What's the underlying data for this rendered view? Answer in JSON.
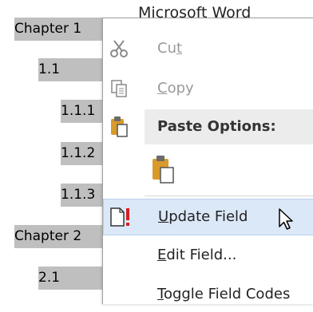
{
  "document": {
    "toc": [
      {
        "label": "Chapter 1"
      },
      {
        "label": "1.1"
      },
      {
        "label": "1.1.1"
      },
      {
        "label": "1.1.2"
      },
      {
        "label": "1.1.3"
      },
      {
        "label": "Chapter 2"
      },
      {
        "label": "2.1"
      }
    ]
  },
  "menu": {
    "title": "Microsoft Word",
    "cut": {
      "label_pre": "Cu",
      "label_key": "t",
      "label_post": "",
      "state": "disabled",
      "icon": "scissors-icon"
    },
    "copy": {
      "label_pre": "",
      "label_key": "C",
      "label_post": "opy",
      "state": "disabled",
      "icon": "copy-icon"
    },
    "paste_options": {
      "label": "Paste Options:",
      "icon": "clipboard-icon"
    },
    "paste_keep": {
      "icon": "paste-keep-source-icon"
    },
    "update_field": {
      "label_pre": "",
      "label_key": "U",
      "label_post": "pdate Field",
      "icon": "update-field-icon"
    },
    "edit_field": {
      "label_pre": "",
      "label_key": "E",
      "label_post": "dit Field...",
      "icon": ""
    },
    "toggle_field_codes": {
      "label_pre": "",
      "label_key": "T",
      "label_post": "oggle Field Codes",
      "icon": ""
    }
  }
}
